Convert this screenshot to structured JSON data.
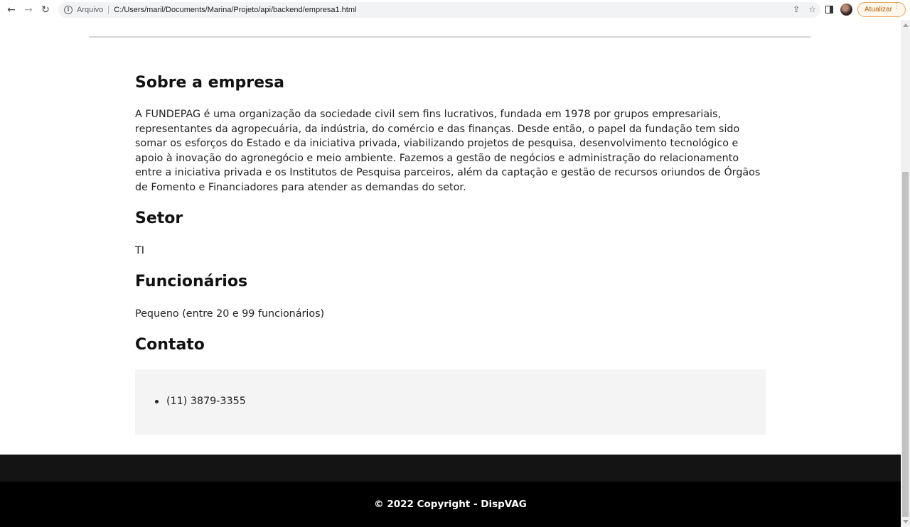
{
  "browser": {
    "back_icon": "←",
    "forward_icon": "→",
    "reload_icon": "↻",
    "info_icon": "i",
    "scheme_label": "Arquivo",
    "url": "C:/Users/maril/Documents/Marina/Projeto/api/backend/empresa1.html",
    "share_icon": "⇪",
    "star_icon": "☆",
    "update_label": "Atualizar",
    "menu_icon": "⋮"
  },
  "about": {
    "heading": "Sobre a empresa",
    "text": "A FUNDEPAG é uma organização da sociedade civil sem fins lucrativos, fundada em 1978 por grupos empresariais, representantes da agropecuária, da indústria, do comércio e das finanças. Desde então, o papel da fundação tem sido somar os esforços do Estado e da iniciativa privada, viabilizando projetos de pesquisa, desenvolvimento tecnológico e apoio à inovação do agronegócio e meio ambiente. Fazemos a gestão de negócios e administração do relacionamento entre a iniciativa privada e os Institutos de Pesquisa parceiros, além da captação e gestão de recursos oriundos de Órgãos de Fomento e Financiadores para atender as demandas do setor."
  },
  "sector": {
    "heading": "Setor",
    "value": "TI"
  },
  "employees": {
    "heading": "Funcionários",
    "value": "Pequeno (entre 20 e 99 funcionários)"
  },
  "contact": {
    "heading": "Contato",
    "items": [
      "(11) 3879-3355"
    ]
  },
  "footer": {
    "text": "© 2022 Copyright - DispVAG"
  }
}
